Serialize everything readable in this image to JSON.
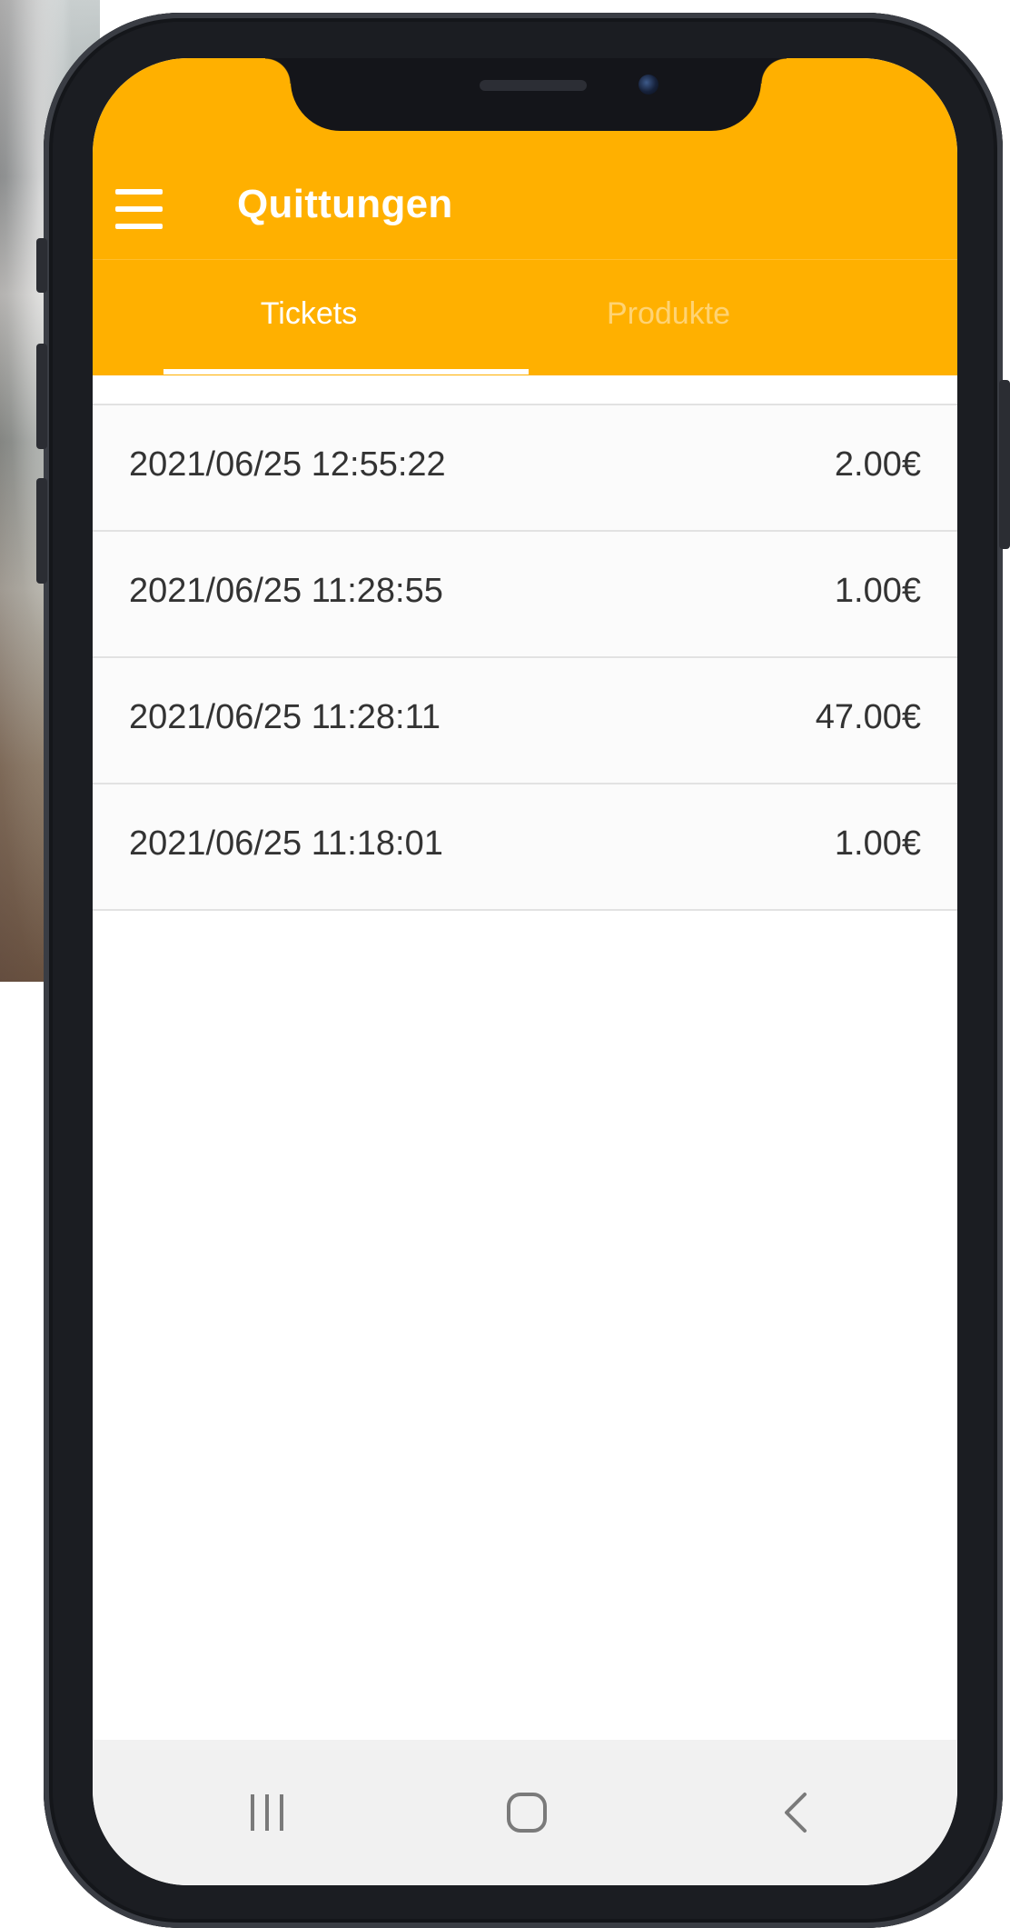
{
  "app_bar": {
    "title": "Quittungen",
    "color": "#FFB000"
  },
  "tabs": [
    {
      "label": "Tickets",
      "active": true
    },
    {
      "label": "Produkte",
      "active": false
    }
  ],
  "tickets": [
    {
      "datetime": "2021/06/25 12:55:22",
      "amount": "2.00€"
    },
    {
      "datetime": "2021/06/25 11:28:55",
      "amount": "1.00€"
    },
    {
      "datetime": "2021/06/25 11:28:11",
      "amount": "47.00€"
    },
    {
      "datetime": "2021/06/25 11:18:01",
      "amount": "1.00€"
    }
  ],
  "icons": {
    "menu": "hamburger-menu-icon",
    "recents": "recent-apps-icon",
    "home": "home-icon",
    "back": "back-chevron-icon"
  }
}
